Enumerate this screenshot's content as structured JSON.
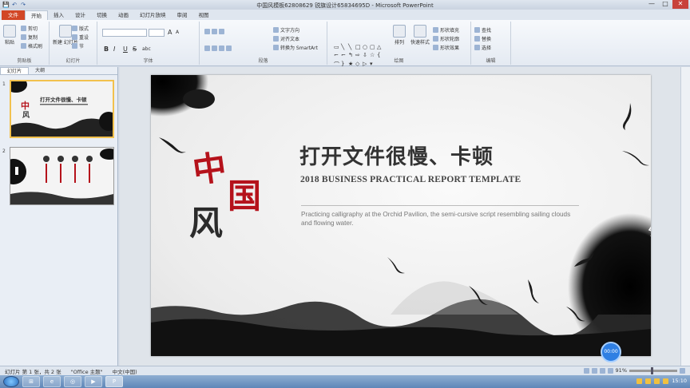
{
  "window": {
    "title": "中国风模板62808629  锐旗设计65834695D  -  Microsoft PowerPoint",
    "close": "✕",
    "maximize": "□",
    "minimize": "—"
  },
  "qat": [
    "💾",
    "↶",
    "↷"
  ],
  "tabs": [
    "文件",
    "开始",
    "插入",
    "设计",
    "切换",
    "动画",
    "幻灯片放映",
    "审阅",
    "视图"
  ],
  "ribbon": {
    "clipboard": {
      "label": "剪贴板",
      "paste": "粘贴",
      "cut": "剪切",
      "copy": "复制",
      "format_painter": "格式刷"
    },
    "slides": {
      "label": "幻灯片",
      "new_slide": "新建\n幻灯片",
      "layout": "版式",
      "reset": "重设",
      "section": "节"
    },
    "font": {
      "label": "字体",
      "bold": "B",
      "italic": "I",
      "underline": "U",
      "strike": "S",
      "shadow": "abc",
      "grow": "A",
      "shrink": "A"
    },
    "paragraph": {
      "label": "段落",
      "text_direction": "文字方向",
      "align_text": "对齐文本",
      "smartart": "转换为 SmartArt"
    },
    "drawing": {
      "label": "绘图",
      "arrange": "排列",
      "quick_styles": "快速样式",
      "fill": "形状填充",
      "outline": "形状轮廓",
      "effects": "形状效果"
    },
    "editing": {
      "label": "编辑",
      "find": "查找",
      "replace": "替换",
      "select": "选择"
    }
  },
  "panel": {
    "tab_slides": "幻灯片",
    "tab_outline": "大纲",
    "slide1_num": "1",
    "slide2_num": "2",
    "thumb1_cn": "打开文件很慢、卡顿",
    "thumb1_callig": "中国风"
  },
  "slide": {
    "callig_1": "中",
    "callig_2": "国",
    "callig_3": "风",
    "title_cn": "打开文件很慢、卡顿",
    "title_en": "2018 BUSINESS PRACTICAL REPORT TEMPLATE",
    "description": "Practicing calligraphy at the Orchid Pavilion, the semi-cursive script resembling sailing clouds and flowing water."
  },
  "recorder": {
    "time": "00:00"
  },
  "status": {
    "slide_info": "幻灯片 第 1 张，共 2 张",
    "theme": "\"Office 主题\"",
    "language": "中文(中国)",
    "zoom": "91%"
  },
  "taskbar": {
    "time": "15:10",
    "apps": [
      "⊞",
      "e",
      "◎",
      "▶",
      "P"
    ]
  },
  "colors": {
    "file_tab": "#d24726",
    "red_callig": "#b5121b",
    "selection": "#f2c14e"
  }
}
